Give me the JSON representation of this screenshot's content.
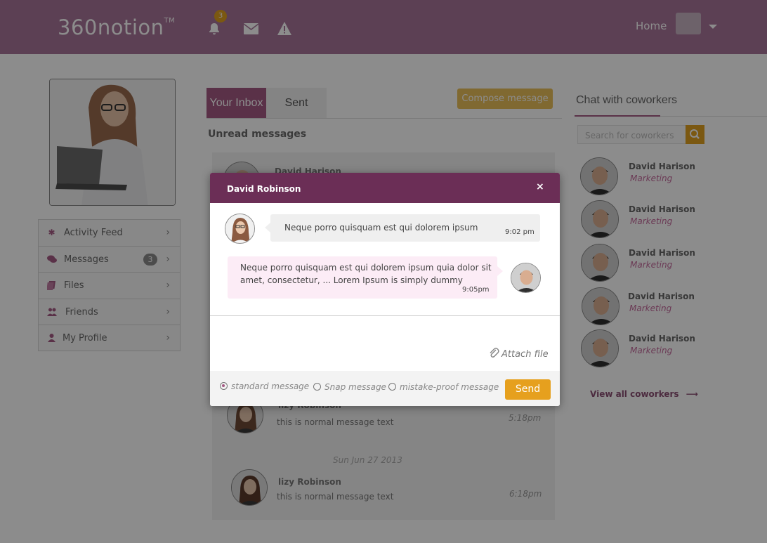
{
  "header": {
    "logo_text": "360notion",
    "logo_tm": "TM",
    "notification_count": "3",
    "home_label": "Home",
    "icons": [
      "bell-icon",
      "envelope-icon",
      "warning-icon"
    ]
  },
  "sidebar": {
    "items": [
      {
        "label": "Activity Feed",
        "icon": "asterisk-icon"
      },
      {
        "label": "Messages",
        "icon": "comments-icon",
        "count": "3"
      },
      {
        "label": "Files",
        "icon": "files-icon"
      },
      {
        "label": "Friends",
        "icon": "friends-icon"
      },
      {
        "label": "My Profile",
        "icon": "user-icon"
      }
    ]
  },
  "inbox": {
    "tabs": [
      "Your Inbox",
      "Sent"
    ],
    "compose_label": "Compose message",
    "section_title": "Unread messages",
    "messages": [
      {
        "name": "David Harison",
        "text": "",
        "time": ""
      },
      {
        "name": "lizy Robinson",
        "text": "this is normal message text",
        "time": "5:18pm"
      },
      {
        "name": "lizy Robinson",
        "text": "this is normal message text",
        "time": "6:18pm"
      }
    ],
    "date_separator": "Sun  Jun 27 2013"
  },
  "chat_panel": {
    "title": "Chat with coworkers",
    "search_placeholder": "Search for coworkers",
    "coworkers": [
      {
        "name": "David Harison",
        "role": "Marketing"
      },
      {
        "name": "David Harison",
        "role": "Marketing"
      },
      {
        "name": "David Harison",
        "role": "Marketing"
      },
      {
        "name": "David Harison",
        "role": "Marketing"
      },
      {
        "name": "David Harison",
        "role": "Marketing"
      }
    ],
    "view_all_label": "View all coworkers"
  },
  "modal": {
    "title": "David Robinson",
    "close_label": "×",
    "messages": [
      {
        "text": "Neque porro quisquam est qui dolorem ipsum",
        "time": "9:02 pm"
      },
      {
        "text_line1": "Neque porro quisquam est qui dolorem ipsum quia dolor sit",
        "text_line2": "amet, consectetur, ... Lorem Ipsum is simply dummy",
        "time": "9:05pm"
      }
    ],
    "attach_label": "Attach file",
    "options": [
      "standard message",
      "Snap message",
      "mistake-proof message"
    ],
    "selected_option": "standard message",
    "send_label": "Send"
  },
  "colors": {
    "header_bg": "#a8769a",
    "modal_header": "#6b2e56",
    "accent": "#a45a83",
    "send_button": "#e6a01e"
  }
}
